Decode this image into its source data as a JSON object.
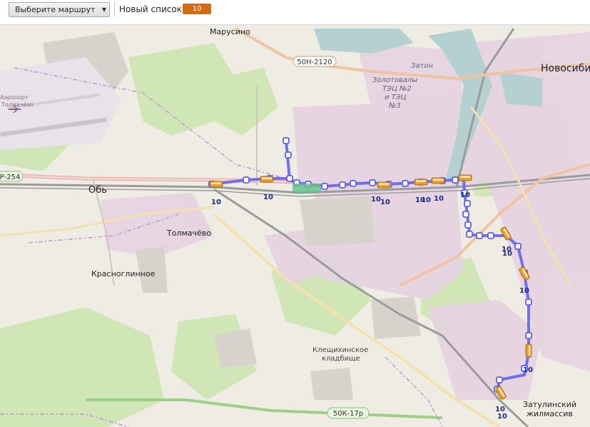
{
  "toolbar": {
    "route_select": "Выберите маршрут",
    "list_label": "Новый список",
    "route_chip": "10"
  },
  "map": {
    "places": {
      "marusino": "Марусино",
      "novosibirsk": "Новосиби",
      "ob": "Обь",
      "tolmachevo": "Толмачёво",
      "krasnoglinnoe": "Красноглинное",
      "zaton": "Затон",
      "zolotovaly1": "Золотовалы",
      "zolotovaly2": "ТЭЦ №2",
      "zolotovaly3": "и ТЭЦ",
      "zolotovaly4": "№3",
      "airport1": "Аэропорт",
      "airport2": "Толмачёво",
      "cemetery1": "Клещихинское",
      "cemetery2": "кладбище",
      "zatulinsky1": "Затулинский",
      "zatulinsky2": "жилмассив"
    },
    "shields": {
      "s1": "50Н-2120",
      "s2": "Р-254",
      "s3": "50К-17р"
    },
    "route_number": "10",
    "route_color": "#5b5ef0",
    "bus_color": "#f0a020"
  }
}
